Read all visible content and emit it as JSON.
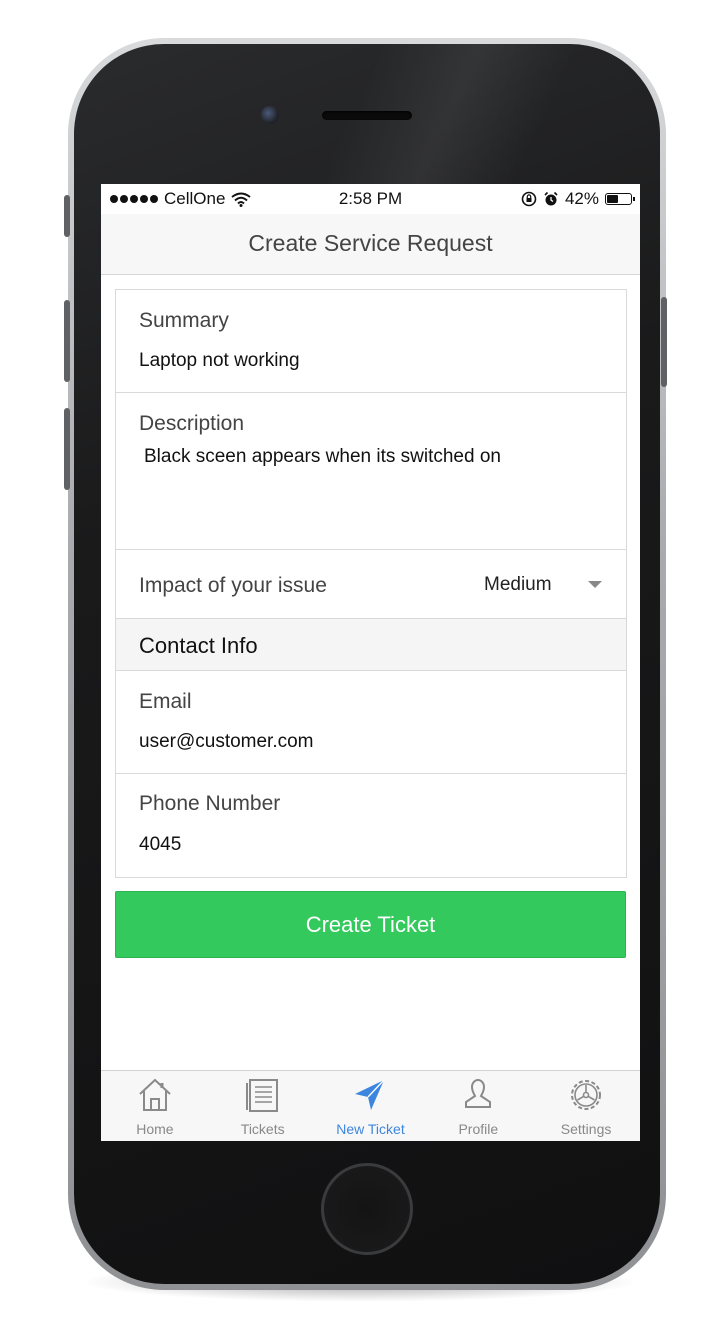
{
  "status_bar": {
    "carrier": "CellOne",
    "time": "2:58 PM",
    "battery": "42%",
    "battery_level": 0.42
  },
  "header": {
    "title": "Create Service Request"
  },
  "form": {
    "summary": {
      "label": "Summary",
      "value": "Laptop not working"
    },
    "description": {
      "label": "Description",
      "value": "Black sceen appears when its switched on"
    },
    "impact": {
      "label": "Impact of your issue",
      "value": "Medium"
    },
    "contact_section": {
      "title": "Contact Info"
    },
    "email": {
      "label": "Email",
      "value": "user@customer.com"
    },
    "phone": {
      "label": "Phone Number",
      "value": "4045"
    }
  },
  "actions": {
    "create_label": "Create Ticket"
  },
  "tabbar": {
    "items": [
      {
        "label": "Home",
        "icon": "home-icon"
      },
      {
        "label": "Tickets",
        "icon": "tickets-icon"
      },
      {
        "label": "New Ticket",
        "icon": "paper-plane-icon",
        "active": true
      },
      {
        "label": "Profile",
        "icon": "profile-icon"
      },
      {
        "label": "Settings",
        "icon": "gear-icon"
      }
    ]
  },
  "colors": {
    "accent": "#3d86e0",
    "primary_button": "#33c95c"
  }
}
